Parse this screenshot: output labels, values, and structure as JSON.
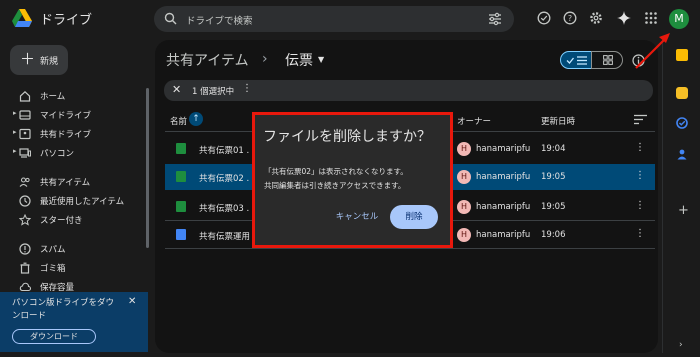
{
  "header": {
    "app_title": "ドライブ",
    "search_placeholder": "ドライブで検索",
    "icons": [
      "drive-logo-icon",
      "search-icon",
      "tune-icon",
      "offline-status-icon",
      "help-icon",
      "settings-icon",
      "gemini-icon",
      "apps-grid-icon"
    ],
    "avatar_letter": "M"
  },
  "sidebar": {
    "new_label": "新規",
    "items": [
      {
        "label": "ホーム",
        "icon": "home-icon"
      },
      {
        "label": "マイドライブ",
        "icon": "my-drive-icon"
      },
      {
        "label": "共有ドライブ",
        "icon": "shared-drive-icon"
      },
      {
        "label": "パソコン",
        "icon": "computer-icon"
      },
      {
        "label": "共有アイテム",
        "icon": "shared-people-icon"
      },
      {
        "label": "最近使用したアイテム",
        "icon": "clock-icon"
      },
      {
        "label": "スター付き",
        "icon": "star-icon"
      },
      {
        "label": "スパム",
        "icon": "spam-icon"
      },
      {
        "label": "ゴミ箱",
        "icon": "trash-icon"
      },
      {
        "label": "保存容量",
        "icon": "cloud-icon"
      }
    ]
  },
  "banner": {
    "text": "パソコン版ドライブをダウンロード",
    "download_label": "ダウンロード"
  },
  "main": {
    "breadcrumb": [
      "共有アイテム",
      "伝票"
    ],
    "breadcrumb_sep": "›",
    "selection": {
      "count_text": "1 個選択中"
    },
    "columns": {
      "name": "名前",
      "owner": "オーナー",
      "modified": "更新日時"
    },
    "rows": [
      {
        "name": "共有伝票01 .",
        "type": "sheet",
        "owner_initial": "H",
        "owner": "hanamaripfu",
        "date": "19:04",
        "selected": false
      },
      {
        "name": "共有伝票02 .",
        "type": "sheet",
        "owner_initial": "H",
        "owner": "hanamaripfu",
        "date": "19:05",
        "selected": true
      },
      {
        "name": "共有伝票03 .",
        "type": "sheet",
        "owner_initial": "H",
        "owner": "hanamaripfu",
        "date": "19:05",
        "selected": false
      },
      {
        "name": "共有伝票運用 .",
        "type": "doc",
        "owner_initial": "H",
        "owner": "hanamaripfu",
        "date": "19:06",
        "selected": false
      }
    ]
  },
  "dialog": {
    "title": "ファイルを削除しますか？",
    "line1": "「共有伝票02」は表示されなくなります。",
    "line2": "共同編集者は引き続きアクセスできます。",
    "cancel_label": "キャンセル",
    "delete_label": "削除"
  },
  "colors": {
    "accent_blue": "#a8c7fa",
    "selected_row": "#004a77",
    "highlight_red": "#e8180c",
    "sheet_green": "#1e8e3e",
    "doc_blue": "#4285f4"
  }
}
